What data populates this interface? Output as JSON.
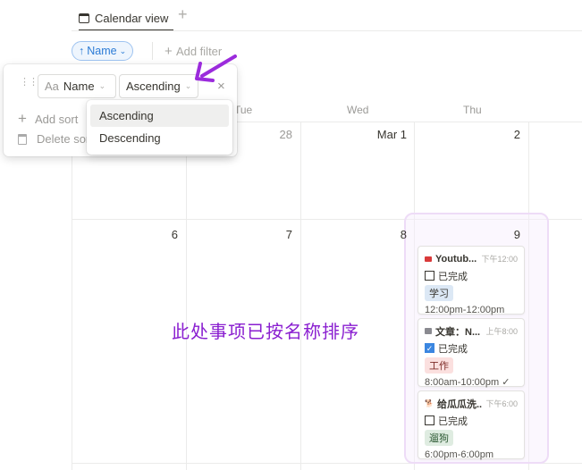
{
  "tab": {
    "label": "Calendar view",
    "icon": "calendar-icon",
    "add": "+"
  },
  "toolbar": {
    "sort_chip": "Name",
    "add_filter": "Add filter"
  },
  "sort_popup": {
    "property": "Name",
    "property_prefix": "Aa",
    "direction": "Ascending",
    "add_sort": "Add sort",
    "delete_sort": "Delete sort"
  },
  "dropdown": {
    "options": [
      "Ascending",
      "Descending"
    ],
    "selected": "Ascending"
  },
  "calendar": {
    "weekdays": [
      "Tue",
      "Wed",
      "Thu"
    ],
    "row1": [
      "28",
      "Mar 1",
      "2"
    ],
    "row2": [
      "6",
      "7",
      "8",
      "9"
    ]
  },
  "events": [
    {
      "title": "Youtub...",
      "time": "下午12:00",
      "done_label": "已完成",
      "done": false,
      "tag": "学习",
      "tag_color": "#dce8f5",
      "range": "12:00pm-12:00pm",
      "icon": "youtube-icon"
    },
    {
      "title": "文章：N...",
      "time": "上午8:00",
      "done_label": "已完成",
      "done": true,
      "tag": "工作",
      "tag_color": "#fbe0df",
      "range": "8:00am-10:00pm ✓",
      "icon": "calendar-icon"
    },
    {
      "title": "给瓜瓜洗...",
      "time": "下午6:00",
      "done_label": "已完成",
      "done": false,
      "tag": "遛狗",
      "tag_color": "#dfece1",
      "range": "6:00pm-6:00pm",
      "icon": "dog-icon"
    }
  ],
  "annotation": "此处事项已按名称排序",
  "colors": {
    "annotation": "#8a1fd0",
    "accent": "#2b7bd6"
  }
}
